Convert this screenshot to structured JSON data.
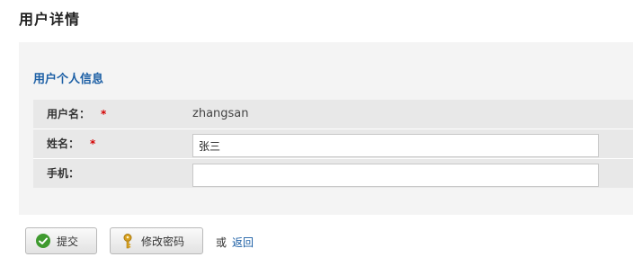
{
  "page": {
    "title": "用户详情"
  },
  "section": {
    "title": "用户个人信息"
  },
  "form": {
    "username": {
      "label": "用户名：",
      "required_mark": "*",
      "value": "zhangsan"
    },
    "name": {
      "label": "姓名：",
      "required_mark": "*",
      "value": "张三"
    },
    "phone": {
      "label": "手机：",
      "value": ""
    }
  },
  "actions": {
    "submit_label": "提交",
    "change_password_label": "修改密码",
    "or_text": "或",
    "back_label": "返回"
  },
  "colors": {
    "accent": "#1c5fa5",
    "required": "#d40000",
    "panel_bg": "#f4f4f4",
    "table_bg": "#e8e8e8"
  }
}
